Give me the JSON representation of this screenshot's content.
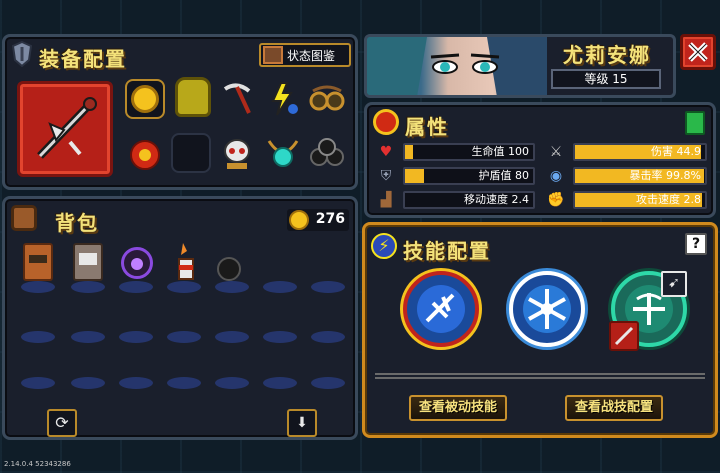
{
  "equipment": {
    "title": "装备配置",
    "status_button": "状态图鉴"
  },
  "character": {
    "name": "尤莉安娜",
    "level": "等级 15"
  },
  "attributes": {
    "title": "属性",
    "stats": [
      {
        "label": "生命值",
        "value": "100",
        "fill": 0.06
      },
      {
        "label": "伤害",
        "value": "44.9",
        "fill": 0.97
      },
      {
        "label": "护盾值",
        "value": "80",
        "fill": 0.15
      },
      {
        "label": "暴击率",
        "value": "99.8%",
        "fill": 0.99
      },
      {
        "label": "移动速度",
        "value": "2.4",
        "fill": 0.0
      },
      {
        "label": "攻击速度",
        "value": "2.8",
        "fill": 0.98
      }
    ]
  },
  "backpack": {
    "title": "背包",
    "gold": "276"
  },
  "skills": {
    "title": "技能配置",
    "help": "?",
    "passive_button": "查看被动技能",
    "combat_button": "查看战技配置"
  },
  "version": "2.14.0.4 52343286",
  "colors": {
    "gold": "#f4e27a",
    "bar": "#f2b822",
    "accent_border": "#c8912e",
    "close": "#c0241c"
  }
}
